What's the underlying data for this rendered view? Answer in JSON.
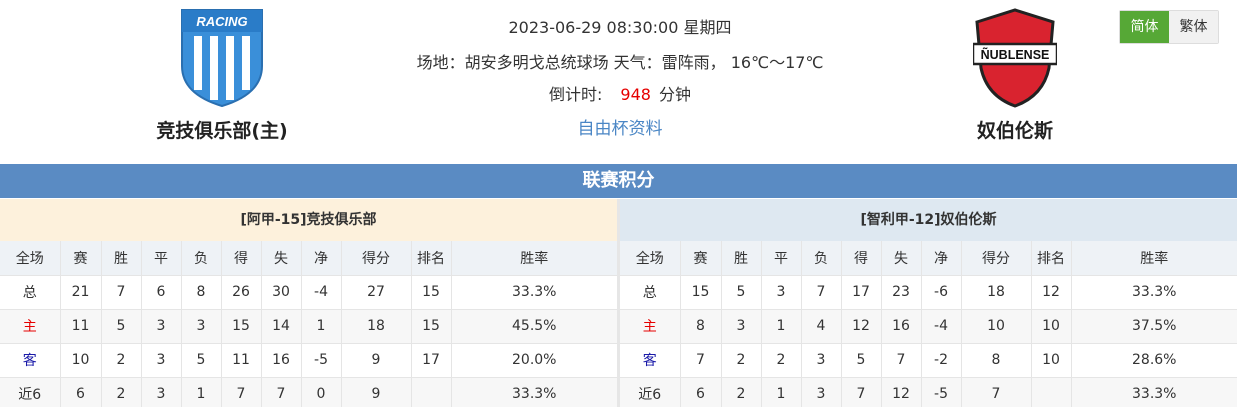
{
  "header": {
    "datetime": "2023-06-29 08:30:00 星期四",
    "venue_line": "场地：胡安多明戈总统球场 天气：雷阵雨， 16℃～17℃",
    "countdown_label": "倒计时:",
    "countdown_value": "948",
    "countdown_unit": "分钟",
    "cup_link": "自由杯资料",
    "home_team": "竞技俱乐部(主)",
    "away_team": "奴伯伦斯",
    "home_logo_text": "RACING",
    "away_logo_text": "ÑUBLENSE"
  },
  "lang": {
    "simplified": "简体",
    "traditional": "繁体"
  },
  "section_title": "联赛积分",
  "columns": [
    "全场",
    "赛",
    "胜",
    "平",
    "负",
    "得",
    "失",
    "净",
    "得分",
    "排名",
    "胜率"
  ],
  "home_standings": {
    "title": "[阿甲-15]竞技俱乐部",
    "rows": [
      [
        "总",
        "21",
        "7",
        "6",
        "8",
        "26",
        "30",
        "-4",
        "27",
        "15",
        "33.3%"
      ],
      [
        "主",
        "11",
        "5",
        "3",
        "3",
        "15",
        "14",
        "1",
        "18",
        "15",
        "45.5%"
      ],
      [
        "客",
        "10",
        "2",
        "3",
        "5",
        "11",
        "16",
        "-5",
        "9",
        "17",
        "20.0%"
      ],
      [
        "近6",
        "6",
        "2",
        "3",
        "1",
        "7",
        "7",
        "0",
        "9",
        "",
        "33.3%"
      ]
    ]
  },
  "away_standings": {
    "title": "[智利甲-12]奴伯伦斯",
    "rows": [
      [
        "总",
        "15",
        "5",
        "3",
        "7",
        "17",
        "23",
        "-6",
        "18",
        "12",
        "33.3%"
      ],
      [
        "主",
        "8",
        "3",
        "1",
        "4",
        "12",
        "16",
        "-4",
        "10",
        "10",
        "37.5%"
      ],
      [
        "客",
        "7",
        "2",
        "2",
        "3",
        "5",
        "7",
        "-2",
        "8",
        "10",
        "28.6%"
      ],
      [
        "近6",
        "6",
        "2",
        "1",
        "3",
        "7",
        "12",
        "-5",
        "7",
        "",
        "33.3%"
      ]
    ]
  },
  "colors": {
    "section_bar": "#5a8bc3",
    "home_header_bg": "#fdf1dc",
    "away_header_bg": "#dee8f1",
    "accent_green": "#56a836",
    "countdown_red": "#e60000",
    "home_label_red": "#e60000",
    "away_label_blue": "#1a1aa8",
    "racing_blue": "#3a8fd9",
    "nublense_red": "#d9232f"
  }
}
